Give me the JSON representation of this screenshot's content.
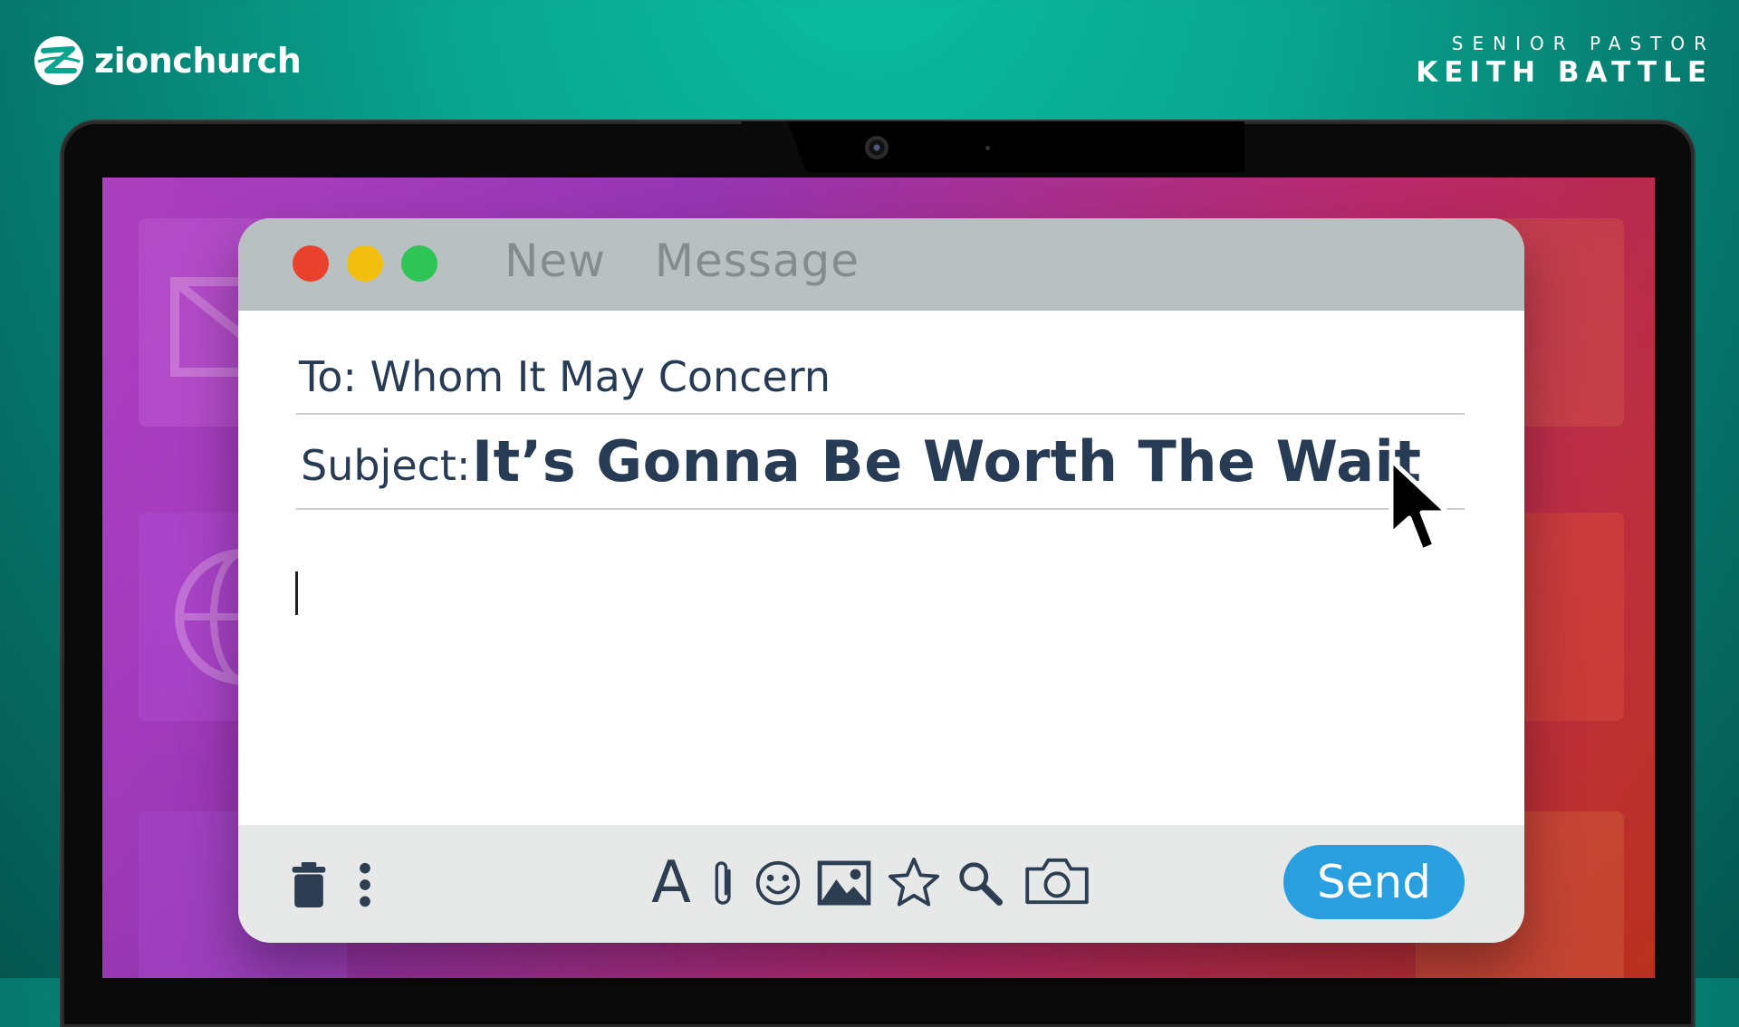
{
  "brand": {
    "name": "zionchurch",
    "logo_icon": "zion-church-logo-icon"
  },
  "pastor": {
    "role": "SENIOR PASTOR",
    "name": "KEITH BATTLE"
  },
  "colors": {
    "teal_background": "#09a58f",
    "window_titlebar": "#b9c0c1",
    "close": "#e9412c",
    "minimize": "#f3bf0f",
    "maximize": "#2ec456",
    "text": "#283b55",
    "send_button": "#2a9fe0",
    "toolbar": "#e7e8e8"
  },
  "window": {
    "title": "New  Message",
    "to_line": "To: Whom It May Concern",
    "subject_label": "Subject:",
    "subject_value": "It’s Gonna Be Worth The Wait",
    "body": ""
  },
  "toolbar": {
    "left_icons": [
      "trash-icon",
      "more-vertical-icon"
    ],
    "center_icons": [
      "font-icon",
      "paperclip-icon",
      "emoji-icon",
      "image-icon",
      "star-icon",
      "search-icon",
      "camera-icon"
    ],
    "font_glyph": "A",
    "send_label": "Send"
  }
}
